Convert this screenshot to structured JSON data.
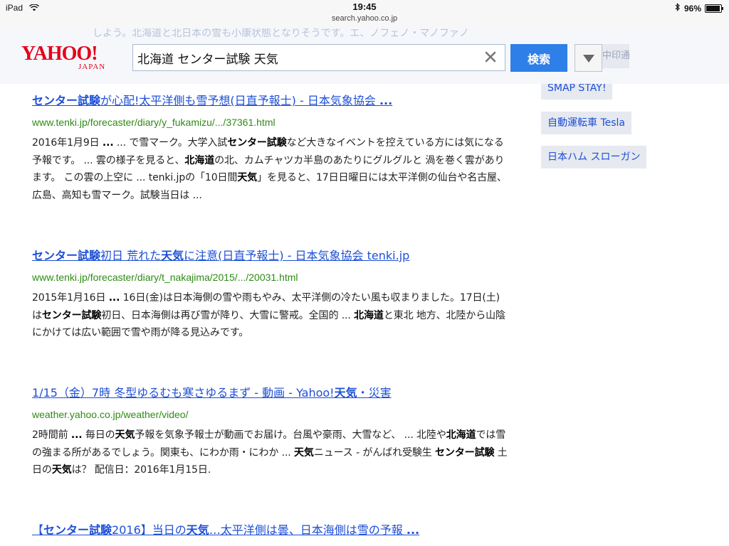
{
  "status": {
    "device": "iPad",
    "time": "19:45",
    "url": "search.yahoo.co.jp",
    "battery": "96%",
    "battery_level": 0.96
  },
  "header": {
    "logo_main": "YAHOO!",
    "logo_sub": "JAPAN",
    "search_value": "北海道 センター試験 天気",
    "search_button": "検索",
    "bleed_text": "しよう。北海道と北日本の雪も小康状態となりそうです。エ、ノフェノ・マノファノ",
    "ghost_tag": "中印通"
  },
  "results": [
    {
      "title": [
        {
          "text": "センター試験",
          "b": true
        },
        {
          "text": "が心配!太平洋側も雪予想(日直予報士) - 日本気象協会 ",
          "b": false
        },
        {
          "text": "...",
          "b": true
        }
      ],
      "url": "www.tenki.jp/forecaster/diary/y_fukamizu/.../37361.html",
      "snippet": [
        {
          "text": "2016年1月9日 ",
          "b": false
        },
        {
          "text": "...",
          "b": true
        },
        {
          "text": " ... で雪マーク。大学入試",
          "b": false
        },
        {
          "text": "センター試験",
          "b": true
        },
        {
          "text": "など大きなイベントを控えている方には気になる 予報です。 ... 雲の様子を見ると、",
          "b": false
        },
        {
          "text": "北海道",
          "b": true
        },
        {
          "text": "の北、カムチャツカ半島のあたりにグルグルと 渦を巻く雲があります。 この雲の上空に ... tenki.jpの「10日間",
          "b": false
        },
        {
          "text": "天気",
          "b": true
        },
        {
          "text": "」を見ると、17日日曜日には太平洋側の仙台や名古屋、広島、高知も雪マーク。試験当日は ...",
          "b": false
        }
      ]
    },
    {
      "title": [
        {
          "text": "センター試験",
          "b": true
        },
        {
          "text": "初日 荒れた",
          "b": false
        },
        {
          "text": "天気",
          "b": true
        },
        {
          "text": "に注意(日直予報士) - 日本気象協会 tenki.jp",
          "b": false
        }
      ],
      "url": "www.tenki.jp/forecaster/diary/t_nakajima/2015/.../20031.html",
      "snippet": [
        {
          "text": "2015年1月16日 ",
          "b": false
        },
        {
          "text": "...",
          "b": true
        },
        {
          "text": " 16日(金)は日本海側の雪や雨もやみ、太平洋側の冷たい風も収まりました。17日(土) は",
          "b": false
        },
        {
          "text": "センター試験",
          "b": true
        },
        {
          "text": "初日、日本海側は再び雪が降り、大雪に警戒。全国的 ... ",
          "b": false
        },
        {
          "text": "北海道",
          "b": true
        },
        {
          "text": "と東北 地方、北陸から山陰にかけては広い範囲で雪や雨が降る見込みです。",
          "b": false
        }
      ]
    },
    {
      "title": [
        {
          "text": "1/15（金）7時 冬型ゆるむも寒さゆるまず - 動画 - Yahoo!",
          "b": false
        },
        {
          "text": "天気",
          "b": true
        },
        {
          "text": "・災害",
          "b": false
        }
      ],
      "url": "weather.yahoo.co.jp/weather/video/",
      "snippet": [
        {
          "text": "2時間前 ",
          "b": false
        },
        {
          "text": "...",
          "b": true
        },
        {
          "text": " 毎日の",
          "b": false
        },
        {
          "text": "天気",
          "b": true
        },
        {
          "text": "予報を気象予報士が動画でお届け。台風や豪雨、大雪など、 ... 北陸や",
          "b": false
        },
        {
          "text": "北海道",
          "b": true
        },
        {
          "text": "では雪の強まる所があるでしょう。関東も、にわか雨・にわか ... ",
          "b": false
        },
        {
          "text": "天気",
          "b": true
        },
        {
          "text": "ニュース - がんばれ受験生 ",
          "b": false
        },
        {
          "text": "センター試験",
          "b": true
        },
        {
          "text": " 土日の",
          "b": false
        },
        {
          "text": "天気",
          "b": true
        },
        {
          "text": "は？ 配信日：2016年1月15日.",
          "b": false
        }
      ]
    },
    {
      "title": [
        {
          "text": "【",
          "b": false
        },
        {
          "text": "センター試験",
          "b": true
        },
        {
          "text": "2016】当日の",
          "b": false
        },
        {
          "text": "天気",
          "b": true
        },
        {
          "text": "…太平洋側は曇、日本海側は雪の予報 ",
          "b": false
        },
        {
          "text": "...",
          "b": true
        }
      ],
      "url": "",
      "snippet": []
    }
  ],
  "side_tags": [
    "SMAP STAY!",
    "自動運転車 Tesla",
    "日本ハム スローガン"
  ]
}
